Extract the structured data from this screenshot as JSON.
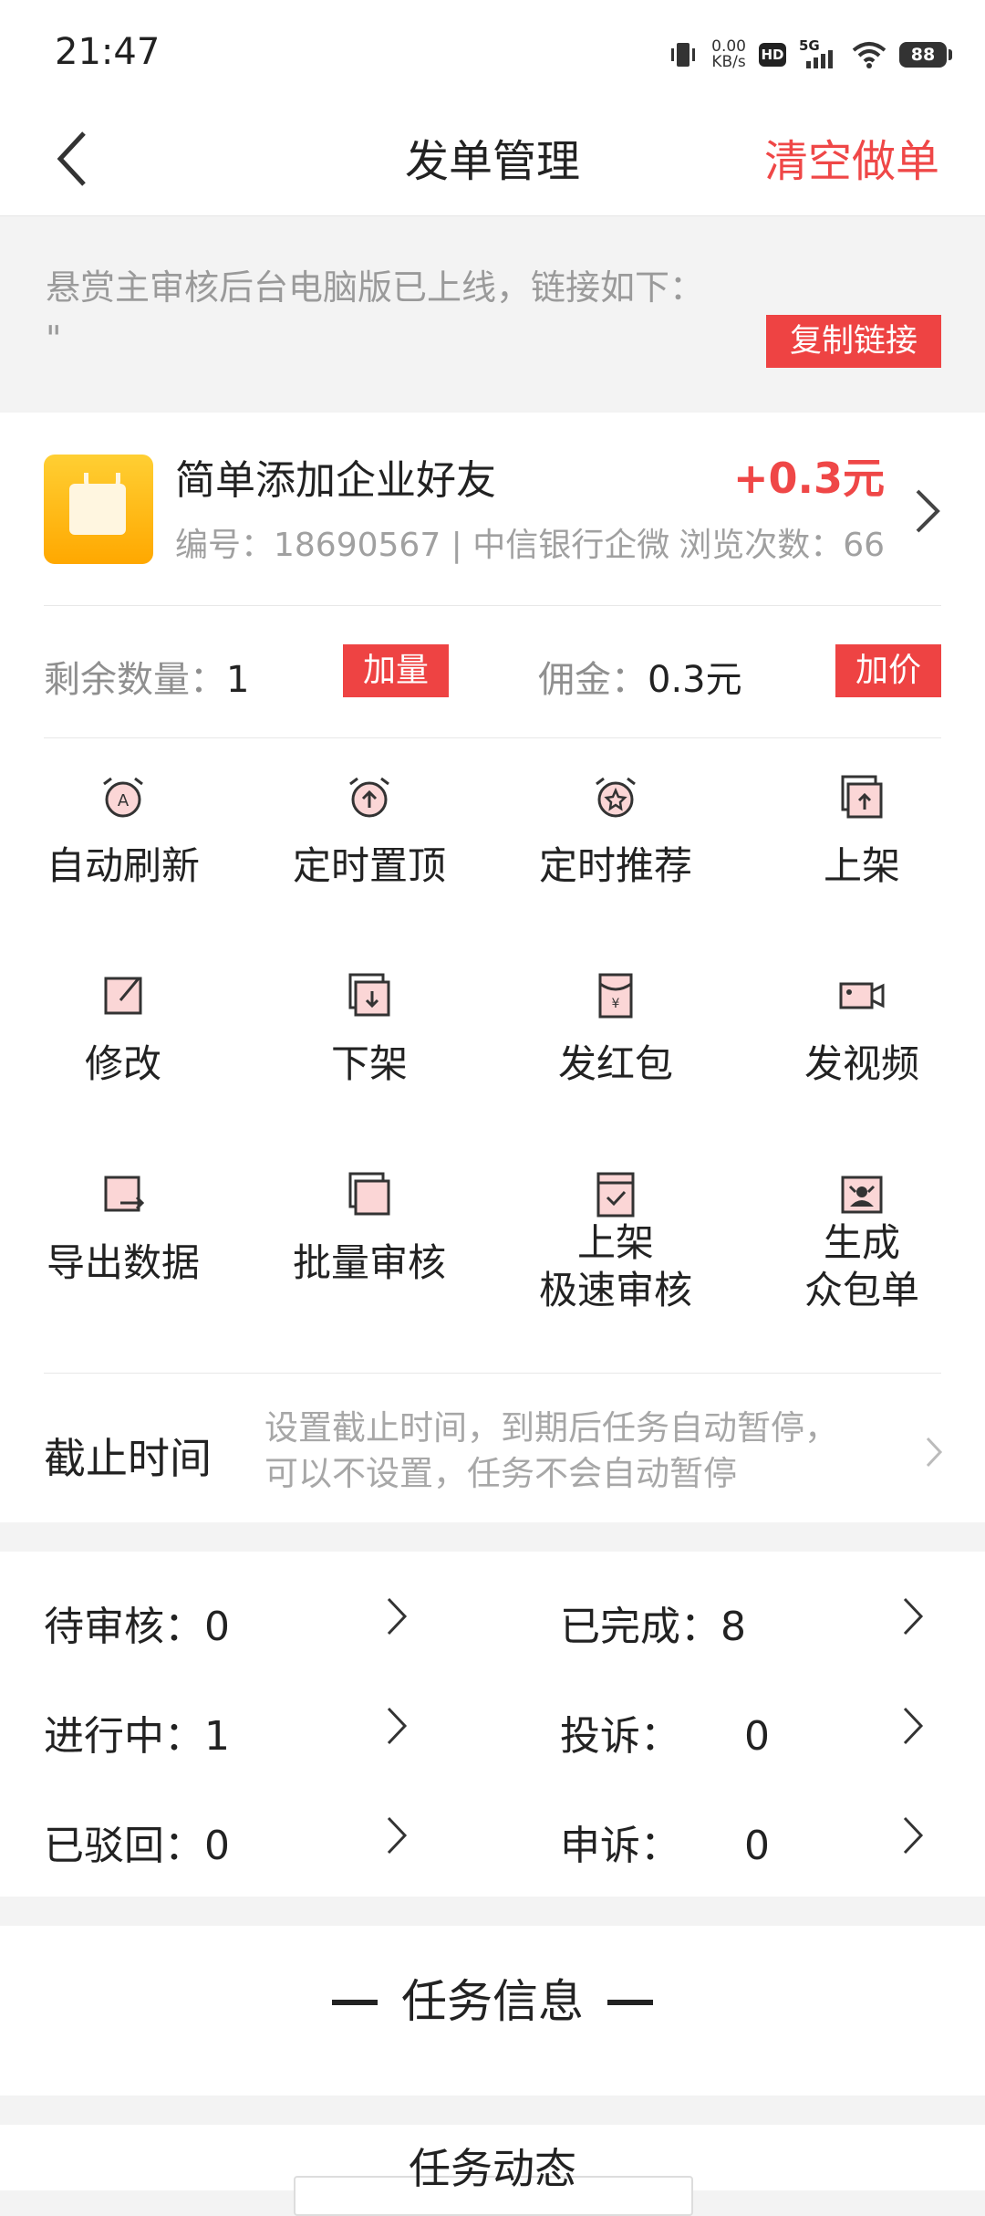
{
  "status": {
    "time": "21:47",
    "net_speed_value": "0.00",
    "net_speed_unit": "KB/s",
    "hd": "HD",
    "network": "5G",
    "battery": "88"
  },
  "header": {
    "title": "发单管理",
    "clear_label": "清空做单"
  },
  "notice": {
    "line1": "悬赏主审核后台电脑版已上线，链接如下：",
    "line2": "\"",
    "copy_label": "复制链接"
  },
  "task": {
    "name": "简单添加企业好友",
    "reward": "+0.3元",
    "meta": "编号：18690567 | 中信银行企微",
    "views": "浏览次数：66",
    "remaining_label": "剩余数量：",
    "remaining_value": "1",
    "add_qty_label": "加量",
    "commission_label": "佣金：",
    "commission_value": "0.3元",
    "add_price_label": "加价"
  },
  "actions": [
    {
      "label": "自动刷新",
      "icon": "auto-refresh-icon"
    },
    {
      "label": "定时置顶",
      "icon": "alarm-top-icon"
    },
    {
      "label": "定时推荐",
      "icon": "alarm-star-icon"
    },
    {
      "label": "上架",
      "icon": "shelf-up-icon"
    },
    {
      "label": "修改",
      "icon": "edit-icon"
    },
    {
      "label": "下架",
      "icon": "shelf-down-icon"
    },
    {
      "label": "发红包",
      "icon": "red-packet-icon"
    },
    {
      "label": "发视频",
      "icon": "video-icon"
    },
    {
      "label": "导出数据",
      "icon": "export-icon"
    },
    {
      "label": "批量审核",
      "icon": "batch-review-icon"
    },
    {
      "label": "上架\n极速审核",
      "icon": "fast-review-icon"
    },
    {
      "label": "生成\n众包单",
      "icon": "crowdsource-icon"
    }
  ],
  "deadline": {
    "label": "截止时间",
    "hint_line1": "设置截止时间，到期后任务自动暂停，",
    "hint_line2": "可以不设置，任务不会自动暂停"
  },
  "stats": {
    "pending_label": "待审核：",
    "pending_value": "0",
    "completed_label": "已完成：",
    "completed_value": "8",
    "in_progress_label": "进行中：",
    "in_progress_value": "1",
    "complaint_label": "投诉：",
    "complaint_value": "0",
    "rejected_label": "已驳回：",
    "rejected_value": "0",
    "appeal_label": "申诉：",
    "appeal_value": "0"
  },
  "info": {
    "title": "任务信息",
    "next_title": "任务动态"
  },
  "colors": {
    "accent": "#ef4747",
    "icon_fill": "#fbd6d6"
  }
}
